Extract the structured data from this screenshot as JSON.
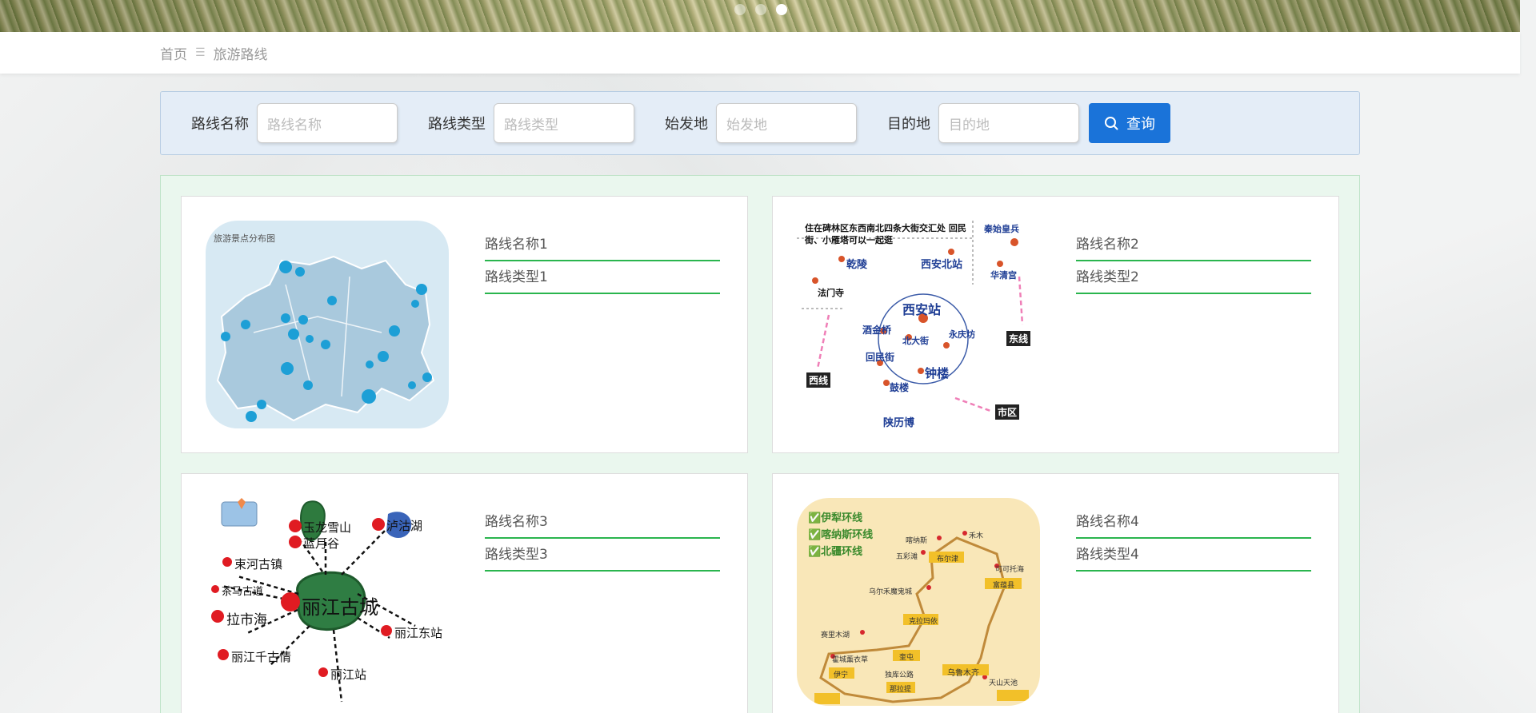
{
  "banner": {
    "slides": 3,
    "active_slide": 3
  },
  "breadcrumb": {
    "home": "首页",
    "separator": "☰",
    "current": "旅游路线"
  },
  "search": {
    "fields": [
      {
        "label": "路线名称",
        "placeholder": "路线名称"
      },
      {
        "label": "路线类型",
        "placeholder": "路线类型"
      },
      {
        "label": "始发地",
        "placeholder": "始发地"
      },
      {
        "label": "目的地",
        "placeholder": "目的地"
      }
    ],
    "button_label": "查询"
  },
  "routes": [
    {
      "name": "路线名称1",
      "type": "路线类型1",
      "map_caption": "旅游景点分布图"
    },
    {
      "name": "路线名称2",
      "type": "路线类型2",
      "map_caption": "住在碑林区东西南北四条大街交汇处 回民街、小雁塔可以一起逛",
      "labels": [
        "乾陵",
        "西安北站",
        "秦始皇兵",
        "华清宫",
        "法门寺",
        "西安站",
        "酒金桥",
        "北大街",
        "永庆坊",
        "回民街",
        "钟楼",
        "鼓楼",
        "东线",
        "西线",
        "市区",
        "陕历博"
      ]
    },
    {
      "name": "路线名称3",
      "type": "路线类型3",
      "labels": [
        "玉龙雪山",
        "蓝月谷",
        "泸沽湖",
        "束河古镇",
        "茶马古道",
        "丽江古城",
        "拉市海",
        "丽江东站",
        "丽江千古情",
        "丽江站"
      ]
    },
    {
      "name": "路线名称4",
      "type": "路线类型4",
      "labels": [
        "✅伊犁环线",
        "✅喀纳斯环线",
        "✅北疆环线",
        "喀纳斯",
        "禾木",
        "五彩滩",
        "布尔津",
        "可可托海",
        "富蕴县",
        "乌尔禾魔鬼城",
        "克拉玛依",
        "赛里木湖",
        "奎屯",
        "乌鲁木齐",
        "霍城薰衣草",
        "伊宁",
        "独库公路",
        "天山天池",
        "那拉提"
      ]
    }
  ],
  "colors": {
    "accent": "#1a73d9",
    "green_line": "#2ab54e"
  }
}
